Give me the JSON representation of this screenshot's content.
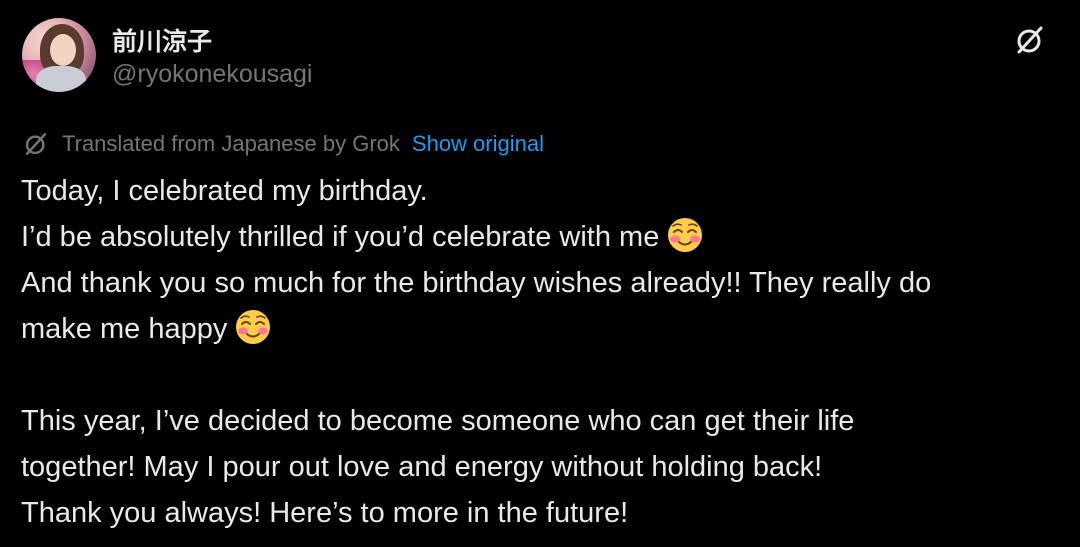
{
  "author": {
    "display_name": "前川涼子",
    "handle": "@ryokonekousagi"
  },
  "header": {
    "grok_icon": "grok-icon",
    "more_icon": "more-icon"
  },
  "translation": {
    "icon": "grok-icon",
    "label": "Translated from Japanese by Grok",
    "show_original": "Show original"
  },
  "tweet": {
    "lines": [
      "Today, I celebrated my birthday.",
      "I’d be absolutely thrilled if you’d celebrate with me",
      "And thank you so much for the birthday wishes already!! They really do",
      "make me happy",
      "",
      "This year, I’ve decided to become someone who can get their life",
      "together! May I pour out love and energy without holding back!",
      "Thank you always! Here’s to more in the future!"
    ],
    "emoji": "smiling-face-with-blush-emoji"
  },
  "colors": {
    "background": "#000000",
    "text_primary": "#e7e9ea",
    "text_secondary": "#71767b",
    "link": "#1d9bf0"
  }
}
